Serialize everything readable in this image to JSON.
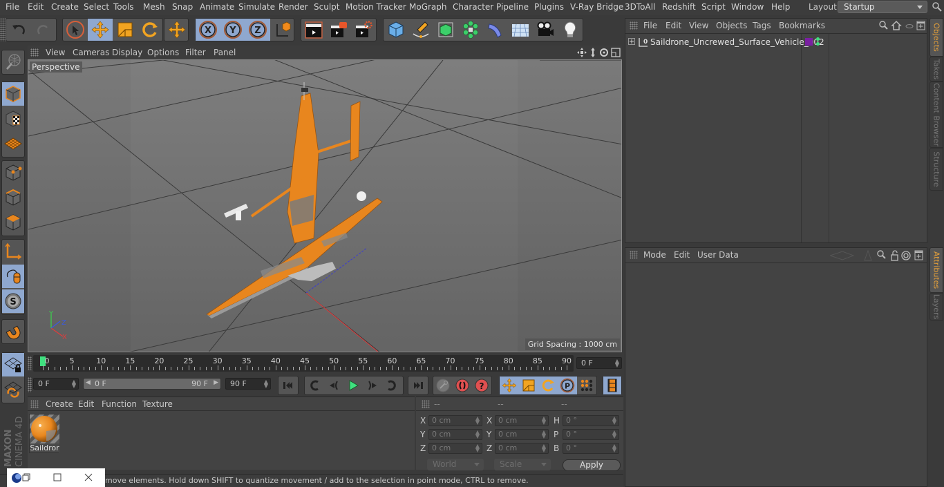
{
  "menubar": {
    "items": [
      "File",
      "Edit",
      "Create",
      "Select",
      "Tools",
      "Mesh",
      "Snap",
      "Animate",
      "Simulate",
      "Render",
      "Sculpt",
      "Motion Tracker",
      "MoGraph",
      "Character",
      "Pipeline",
      "Plugins",
      "V-Ray Bridge",
      "3DToAll",
      "Redshift",
      "Script",
      "Window",
      "Help"
    ],
    "layout_label": "Layout:",
    "layout_value": "Startup"
  },
  "toolbar": {
    "buttons": [
      {
        "icon": "undo-icon",
        "selected": false
      },
      {
        "icon": "redo-icon",
        "selected": false,
        "disabled": true
      },
      {
        "icon": "live-selection-icon",
        "selected": false
      },
      {
        "icon": "move-icon",
        "selected": true
      },
      {
        "icon": "scale-icon",
        "selected": false
      },
      {
        "icon": "rotate-icon",
        "selected": false
      },
      {
        "icon": "recent-tool-icon",
        "selected": false
      },
      {
        "icon": "x-axis-lock-icon",
        "selected": true
      },
      {
        "icon": "y-axis-lock-icon",
        "selected": true
      },
      {
        "icon": "z-axis-lock-icon",
        "selected": true
      },
      {
        "icon": "coordinate-system-icon",
        "selected": false
      },
      {
        "icon": "render-view-icon",
        "selected": false
      },
      {
        "icon": "render-picture-viewer-icon",
        "selected": false
      },
      {
        "icon": "render-settings-icon",
        "selected": false
      },
      {
        "icon": "cube-primitive-icon",
        "selected": false
      },
      {
        "icon": "spline-pen-icon",
        "selected": false
      },
      {
        "icon": "subdivision-surface-icon",
        "selected": false
      },
      {
        "icon": "cloner-icon",
        "selected": false
      },
      {
        "icon": "bend-deformer-icon",
        "selected": false
      },
      {
        "icon": "floor-environment-icon",
        "selected": false
      },
      {
        "icon": "camera-icon",
        "selected": false
      },
      {
        "icon": "light-icon",
        "selected": false
      }
    ]
  },
  "left_toolbar": {
    "buttons": [
      {
        "icon": "make-editable-icon",
        "selected": false
      },
      {
        "icon": "model-mode-icon",
        "selected": true
      },
      {
        "icon": "texture-mode-icon",
        "selected": false
      },
      {
        "icon": "workplane-mode-icon",
        "selected": false
      },
      {
        "icon": "points-mode-icon",
        "selected": false
      },
      {
        "icon": "edges-mode-icon",
        "selected": false
      },
      {
        "icon": "polygons-mode-icon",
        "selected": false
      },
      {
        "icon": "axis-mode-icon",
        "selected": false
      },
      {
        "icon": "tweak-mode-icon",
        "selected": true
      },
      {
        "icon": "solo-mode-icon",
        "selected": true
      },
      {
        "icon": "snap-magnet-icon",
        "selected": false
      },
      {
        "icon": "lock-workplane-icon",
        "selected": true
      },
      {
        "icon": "align-workplane-icon",
        "selected": false
      }
    ],
    "brand_top": "MAXON",
    "brand_bottom": "CINEMA 4D"
  },
  "viewport": {
    "menu": [
      "View",
      "Cameras",
      "Display",
      "Options",
      "Filter",
      "Panel"
    ],
    "camera_label": "Perspective",
    "grid_spacing": "Grid Spacing : 1000 cm",
    "nav_icons": [
      "pan-icon",
      "dolly-icon",
      "orbit-icon",
      "maximize-view-icon"
    ],
    "axis": {
      "x": "X",
      "y": "Y",
      "z": "Z"
    },
    "colors": {
      "x": "#e03c3c",
      "y": "#3ccf4e",
      "z": "#3c5ae0",
      "model": "#e8861e"
    }
  },
  "timeline": {
    "ticks": [
      0,
      5,
      10,
      15,
      20,
      25,
      30,
      35,
      40,
      45,
      50,
      55,
      60,
      65,
      70,
      75,
      80,
      85,
      90
    ],
    "current_frame": 0,
    "current_frame_field": "0 F",
    "playhead_color": "#3fe07f"
  },
  "transport": {
    "start_field": "0 F",
    "range_start": "0 F",
    "range_end": "90 F",
    "end_field": "90 F",
    "buttons": [
      "go-to-start-icon",
      "go-to-previous-key-icon",
      "previous-frame-icon",
      "play-icon",
      "next-frame-icon",
      "go-to-next-key-icon",
      "go-to-end-icon",
      "record-active-objects-icon",
      "autokey-icon",
      "keyframe-selection-icon",
      "record-position-icon",
      "record-scale-icon",
      "record-rotation-icon",
      "record-parameter-icon",
      "record-pla-icon",
      "timeline-icon"
    ]
  },
  "material_panel": {
    "menu": [
      "Create",
      "Edit",
      "Function",
      "Texture"
    ],
    "materials": [
      {
        "name": "Saildror",
        "color": "#e8861e"
      }
    ]
  },
  "coord_panel": {
    "headers": [
      "--",
      "--",
      "--"
    ],
    "rows": [
      {
        "l1": "X",
        "v1": "0 cm",
        "l2": "X",
        "v2": "0 cm",
        "l3": "H",
        "v3": "0 °"
      },
      {
        "l1": "Y",
        "v1": "0 cm",
        "l2": "Y",
        "v2": "0 cm",
        "l3": "P",
        "v3": "0 °"
      },
      {
        "l1": "Z",
        "v1": "0 cm",
        "l2": "Z",
        "v2": "0 cm",
        "l3": "B",
        "v3": "0 °"
      }
    ],
    "coord_mode": "World",
    "size_mode": "Scale",
    "apply_label": "Apply"
  },
  "status_bar": {
    "text": "move elements. Hold down SHIFT to quantize movement / add to the selection in point mode, CTRL to remove."
  },
  "object_manager": {
    "menu": [
      "File",
      "Edit",
      "View",
      "Objects",
      "Tags",
      "Bookmarks"
    ],
    "objects": [
      {
        "name": "Saildrone_Uncrewed_Surface_Vehicle_002",
        "layer_color": "#7a1fa2",
        "visible_editor": "#3fe07f",
        "visible_render": "#3fe07f"
      }
    ]
  },
  "attribute_manager": {
    "menu": [
      "Mode",
      "Edit",
      "User Data"
    ]
  },
  "side_tabs": {
    "top": [
      {
        "label": "Objects",
        "active": true
      },
      {
        "label": "Takes",
        "active": false
      },
      {
        "label": "Content Browser",
        "active": false
      },
      {
        "label": "Structure",
        "active": false
      }
    ],
    "bottom": [
      {
        "label": "Attributes",
        "active": true
      },
      {
        "label": "Layers",
        "active": false
      }
    ]
  }
}
